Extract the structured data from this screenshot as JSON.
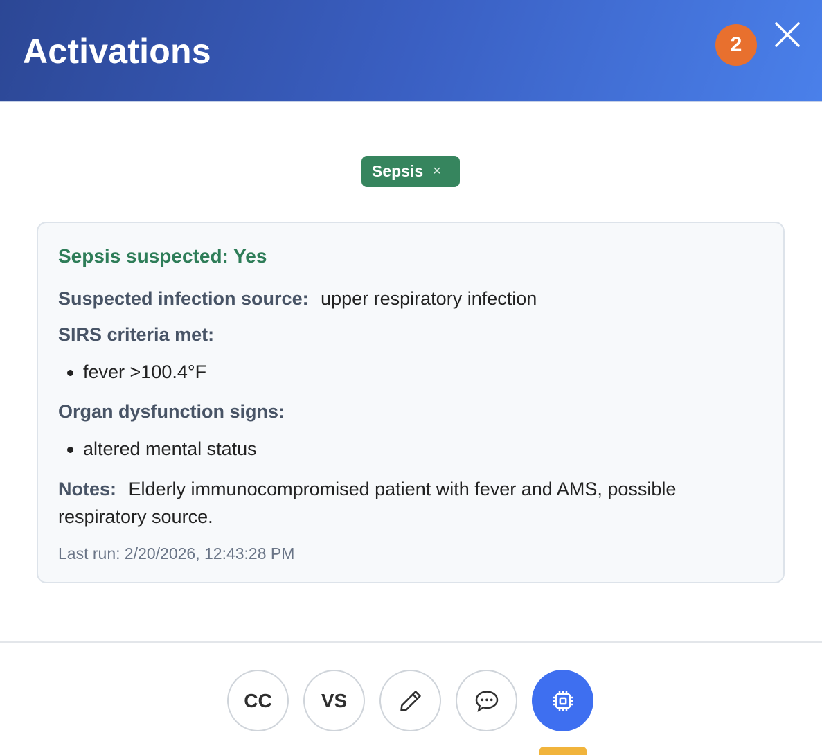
{
  "header": {
    "title": "Activations",
    "badge_count": "2"
  },
  "tag": {
    "label": "Sepsis",
    "close_glyph": "×"
  },
  "card": {
    "status": "Sepsis suspected: Yes",
    "infection_source_label": "Suspected infection source:",
    "infection_source_value": "upper respiratory infection",
    "sirs_label": "SIRS criteria met:",
    "sirs_items": [
      "fever >100.4°F"
    ],
    "organ_label": "Organ dysfunction signs:",
    "organ_items": [
      "altered mental status"
    ],
    "notes_label": "Notes:",
    "notes_value": "Elderly immunocompromised patient with fever and AMS, possible respiratory source.",
    "last_run": "Last run: 2/20/2026, 12:43:28 PM"
  },
  "toolbar": {
    "cc_label": "CC",
    "vs_label": "VS",
    "edit_icon": "pencil-icon",
    "chat_icon": "chat-bubble-icon",
    "ai_icon": "chip-icon"
  },
  "colors": {
    "header_start": "#2c4795",
    "header_end": "#4a80ea",
    "badge": "#e8702e",
    "tag": "#36855e",
    "status_green": "#2e7d58",
    "active_button": "#3e6ff0"
  }
}
